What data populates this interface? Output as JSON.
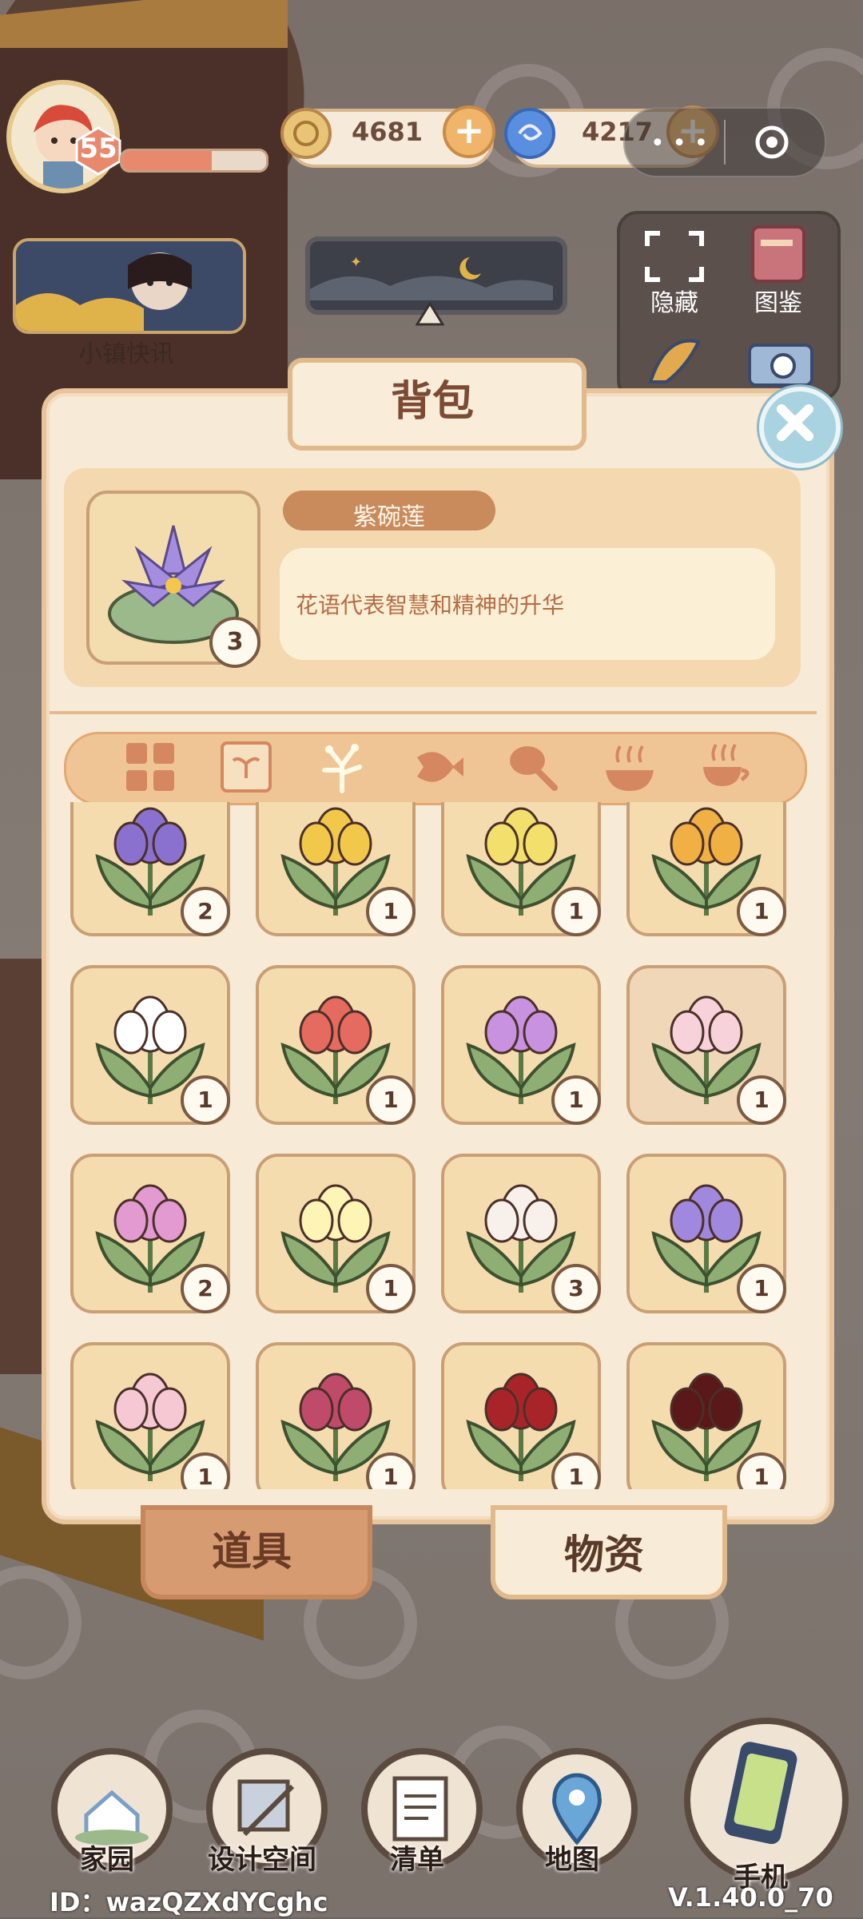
{
  "hud": {
    "level": "55",
    "xp_fraction": 0.62,
    "currency_coins": "4681",
    "currency_gems": "4217",
    "news_label": "小镇快讯"
  },
  "tools_panel": {
    "hide_label": "隐藏",
    "album_label": "图鉴"
  },
  "modal": {
    "title": "背包",
    "selected_item": {
      "name": "紫碗莲",
      "count": "3",
      "description": "花语代表智慧和精神的升华"
    },
    "categories": [
      "grid-icon",
      "seed-icon",
      "flower-icon",
      "fish-icon",
      "meat-icon",
      "bowl-icon",
      "tea-icon"
    ],
    "active_category": 2,
    "items": [
      {
        "name": "purple-tulip",
        "count": "2",
        "color": "#8a71cf"
      },
      {
        "name": "yellow-daffodil",
        "count": "1",
        "color": "#f2c84b"
      },
      {
        "name": "yellow-calla",
        "count": "1",
        "color": "#f3df6b"
      },
      {
        "name": "orange-lily",
        "count": "1",
        "color": "#f0b043"
      },
      {
        "name": "white-lily",
        "count": "1",
        "color": "#ffffff"
      },
      {
        "name": "red-flower",
        "count": "1",
        "color": "#e56a60"
      },
      {
        "name": "violet-flower",
        "count": "1",
        "color": "#c892e0"
      },
      {
        "name": "pink-lily",
        "count": "1",
        "color": "#f8d2da"
      },
      {
        "name": "pink-hydrangea",
        "count": "2",
        "color": "#e29ad0"
      },
      {
        "name": "cream-lily",
        "count": "1",
        "color": "#fdf4b5"
      },
      {
        "name": "white-tulip",
        "count": "3",
        "color": "#f8f0ea"
      },
      {
        "name": "lavender-flower",
        "count": "1",
        "color": "#9f88de"
      },
      {
        "name": "pink-tulip",
        "count": "1",
        "color": "#f6c8d4"
      },
      {
        "name": "red-chrysanthemum",
        "count": "1",
        "color": "#c04a6a"
      },
      {
        "name": "red-carnation",
        "count": "1",
        "color": "#a92429"
      },
      {
        "name": "dark-calla",
        "count": "1",
        "color": "#5a1818"
      }
    ],
    "tabs": {
      "tools": "道具",
      "materials": "物资"
    }
  },
  "nav": {
    "home": "家园",
    "design": "设计空间",
    "list": "清单",
    "map": "地图",
    "phone": "手机"
  },
  "footer": {
    "id": "ID：wazQZXdYCghc",
    "version": "V.1.40.0_70"
  }
}
